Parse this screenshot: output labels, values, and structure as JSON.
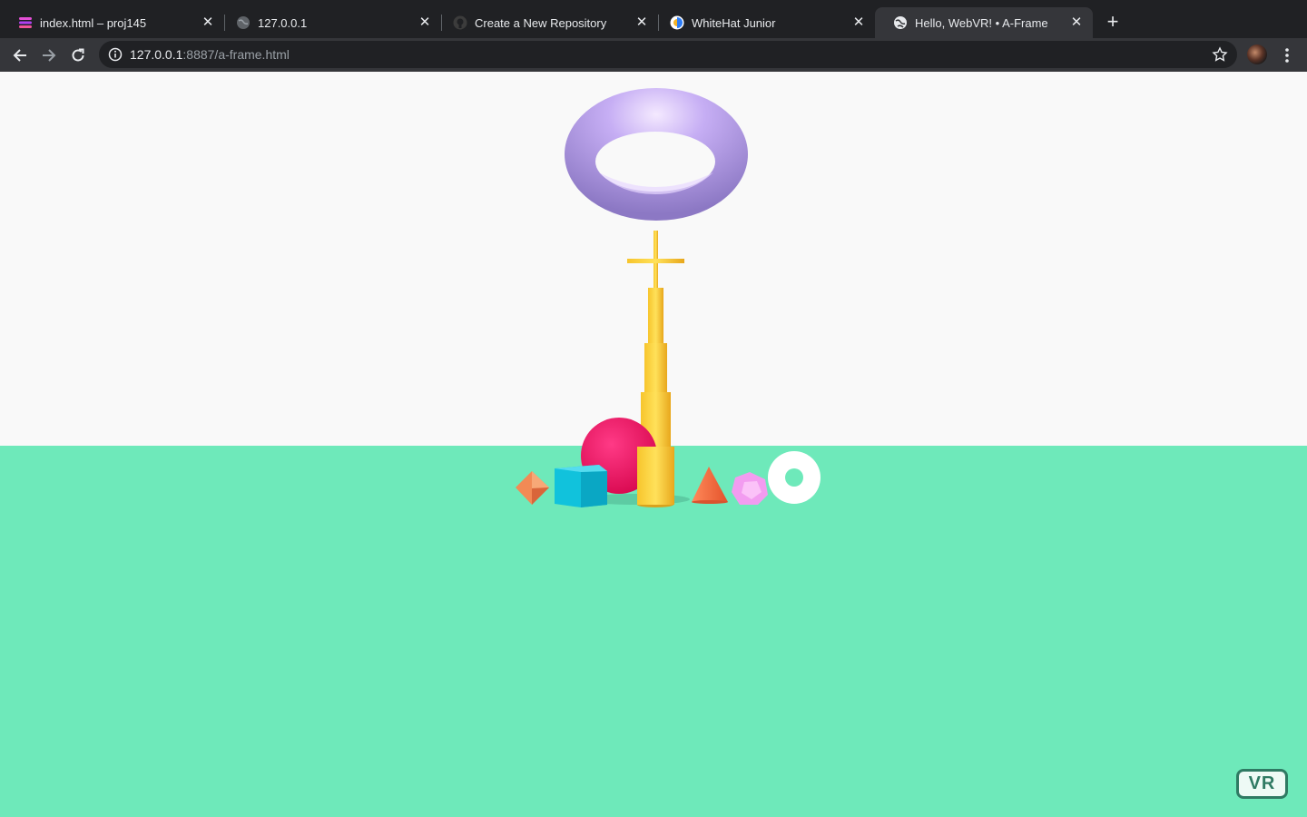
{
  "browser": {
    "tabs": [
      {
        "title": "index.html – proj145",
        "icon": "code-editor-icon"
      },
      {
        "title": "127.0.0.1",
        "icon": "globe-icon"
      },
      {
        "title": "Create a New Repository",
        "icon": "github-icon"
      },
      {
        "title": "WhiteHat Junior",
        "icon": "whitehat-icon"
      },
      {
        "title": "Hello, WebVR! • A-Frame",
        "icon": "globe-icon",
        "active": true
      }
    ],
    "url_host": "127.0.0.1",
    "url_rest": ":8887/a-frame.html"
  },
  "scene": {
    "sky_color": "#f9f9f9",
    "ground_color": "#6ee9ba",
    "objects": [
      {
        "name": "torus-ring",
        "color": "#9a86d8"
      },
      {
        "name": "spire-with-cross",
        "color": "#ffd43b"
      },
      {
        "name": "sphere",
        "color": "#f0145e"
      },
      {
        "name": "octahedron",
        "color": "#f28a55"
      },
      {
        "name": "cube",
        "color": "#11c2dc"
      },
      {
        "name": "cone",
        "color": "#f4683c"
      },
      {
        "name": "dodecahedron",
        "color": "#f29cf0"
      },
      {
        "name": "white-ring",
        "color": "#ffffff"
      }
    ],
    "vr_button_label": "VR"
  }
}
